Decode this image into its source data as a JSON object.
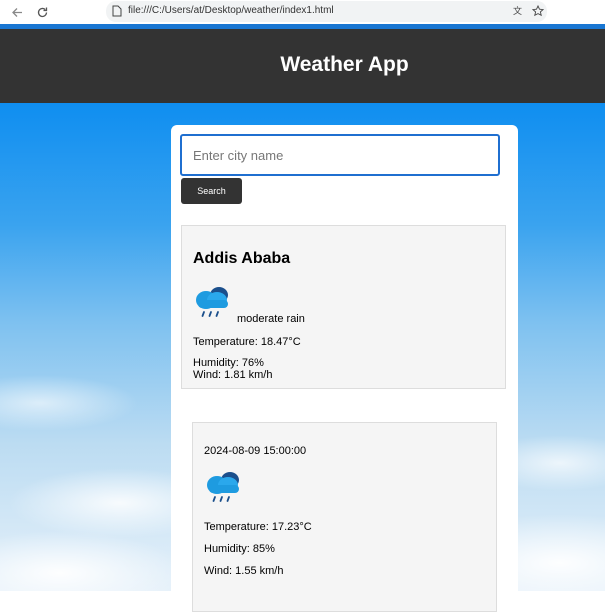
{
  "browser": {
    "url": "file:///C:/Users/at/Desktop/weather/index1.html"
  },
  "header": {
    "title": "Weather App"
  },
  "search": {
    "placeholder": "Enter city name",
    "value": "",
    "button_label": "Search"
  },
  "current": {
    "city": "Addis Ababa",
    "icon": "rain-cloud-icon",
    "description": "moderate rain",
    "temperature": "Temperature: 18.47°C",
    "humidity": "Humidity: 76%",
    "wind": "Wind: 1.81 km/h"
  },
  "forecast": [
    {
      "datetime": "2024-08-09 15:00:00",
      "icon": "rain-cloud-icon",
      "temperature": "Temperature: 17.23°C",
      "humidity": "Humidity: 85%",
      "wind": "Wind: 1.55 km/h"
    }
  ],
  "colors": {
    "header_bg": "#333333",
    "accent": "#1976d2",
    "input_border": "#1f6fd0",
    "box_bg": "#f5f5f5"
  }
}
